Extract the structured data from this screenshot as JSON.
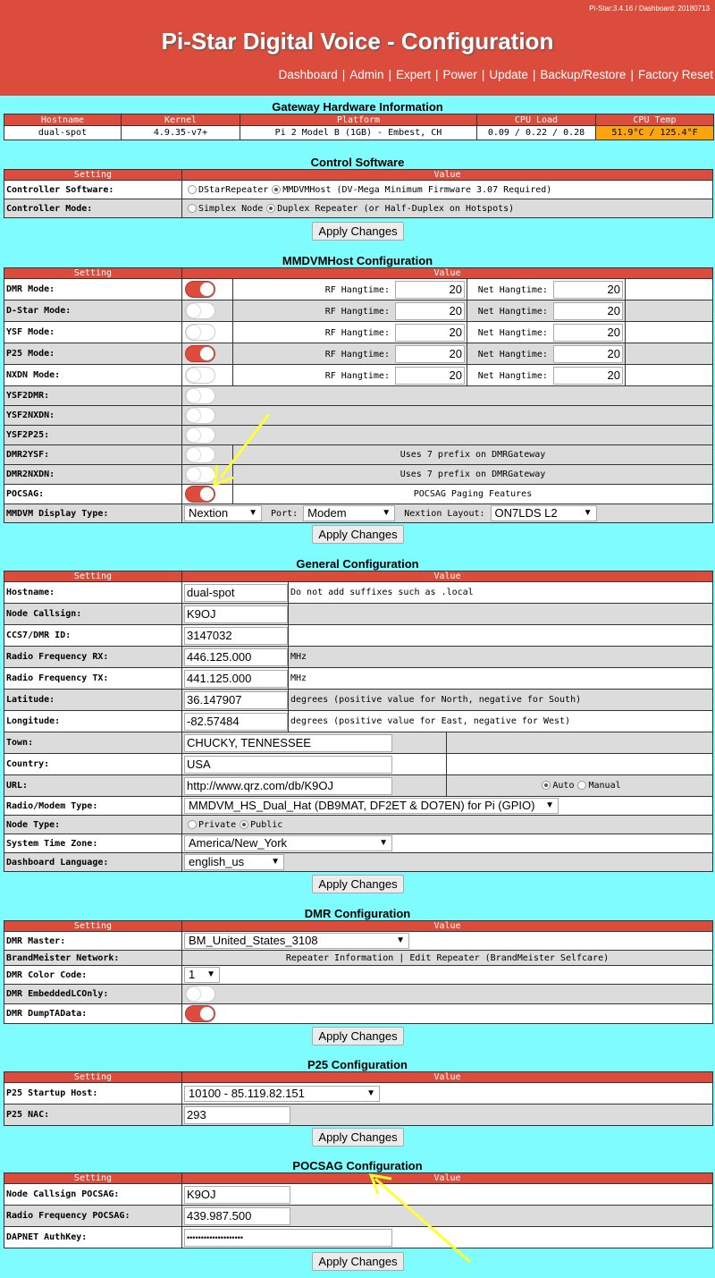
{
  "header": {
    "version": "Pi-Star:3.4.16 / Dashboard: 20180713",
    "title": "Pi-Star Digital Voice - Configuration",
    "nav": [
      "Dashboard",
      "Admin",
      "Expert",
      "Power",
      "Update",
      "Backup/Restore",
      "Factory Reset"
    ]
  },
  "apply_label": "Apply Changes",
  "gateway": {
    "title": "Gateway Hardware Information",
    "headers": [
      "Hostname",
      "Kernel",
      "Platform",
      "CPU Load",
      "CPU Temp"
    ],
    "values": [
      "dual-spot",
      "4.9.35-v7+",
      "Pi 2 Model B (1GB) - Embest, CH",
      "0.09 / 0.22 / 0.28",
      "51.9°C / 125.4°F"
    ],
    "temp_color": "#fca40d"
  },
  "columns": {
    "setting": "Setting",
    "value": "Value"
  },
  "control": {
    "title": "Control Software",
    "software_label": "Controller Software:",
    "software_options": [
      "DStarRepeater",
      "MMDVMHost (DV-Mega Minimum Firmware 3.07 Required)"
    ],
    "software_selected": "MMDVMHost",
    "mode_label": "Controller Mode:",
    "mode_options": [
      "Simplex Node",
      "Duplex Repeater (or Half-Duplex on Hotspots)"
    ],
    "mode_selected": "Duplex Repeater"
  },
  "mmdvm": {
    "title": "MMDVMHost Configuration",
    "rf_label": "RF Hangtime:",
    "net_label": "Net Hangtime:",
    "modes": [
      {
        "label": "DMR Mode:",
        "on": true,
        "rf": "20",
        "net": "20"
      },
      {
        "label": "D-Star Mode:",
        "on": false,
        "rf": "20",
        "net": "20"
      },
      {
        "label": "YSF Mode:",
        "on": false,
        "rf": "20",
        "net": "20"
      },
      {
        "label": "P25 Mode:",
        "on": true,
        "rf": "20",
        "net": "20"
      },
      {
        "label": "NXDN Mode:",
        "on": false,
        "rf": "20",
        "net": "20"
      }
    ],
    "ysf2dmr": "YSF2DMR:",
    "ysf2nxdn": "YSF2NXDN:",
    "ysf2p25": "YSF2P25:",
    "dmr2ysf": "DMR2YSF:",
    "dmr2ysf_note": "Uses 7 prefix on DMRGateway",
    "dmr2nxdn": "DMR2NXDN:",
    "dmr2nxdn_note": "Uses 7 prefix on DMRGateway",
    "pocsag": "POCSAG:",
    "pocsag_on": true,
    "pocsag_note": "POCSAG Paging Features",
    "display_label": "MMDVM Display Type:",
    "display_value": "Nextion",
    "port_label": "Port:",
    "port_value": "Modem",
    "layout_label": "Nextion Layout:",
    "layout_value": "ON7LDS L2"
  },
  "general": {
    "title": "General Configuration",
    "hostname_label": "Hostname:",
    "hostname": "dual-spot",
    "hostname_note": "Do not add suffixes such as .local",
    "callsign_label": "Node Callsign:",
    "callsign": "K9OJ",
    "dmrid_label": "CCS7/DMR ID:",
    "dmrid": "3147032",
    "rx_label": "Radio Frequency RX:",
    "rx": "446.125.000",
    "rx_unit": "MHz",
    "tx_label": "Radio Frequency TX:",
    "tx": "441.125.000",
    "tx_unit": "MHz",
    "lat_label": "Latitude:",
    "lat": "36.147907",
    "lat_note": "degrees (positive value for North, negative for South)",
    "lon_label": "Longitude:",
    "lon": "-82.57484",
    "lon_note": "degrees (positive value for East, negative for West)",
    "town_label": "Town:",
    "town": "CHUCKY, TENNESSEE",
    "country_label": "Country:",
    "country": "USA",
    "url_label": "URL:",
    "url": "http://www.qrz.com/db/K9OJ",
    "url_auto": "Auto",
    "url_manual": "Manual",
    "modem_label": "Radio/Modem Type:",
    "modem": "MMDVM_HS_Dual_Hat (DB9MAT, DF2ET & DO7EN) for Pi (GPIO)",
    "nodetype_label": "Node Type:",
    "private": "Private",
    "public": "Public",
    "tz_label": "System Time Zone:",
    "tz": "America/New_York",
    "lang_label": "Dashboard Language:",
    "lang": "english_us"
  },
  "dmr": {
    "title": "DMR Configuration",
    "master_label": "DMR Master:",
    "master": "BM_United_States_3108",
    "bm_label": "BrandMeister Network:",
    "bm_links": "Repeater Information | Edit Repeater (BrandMeister Selfcare)",
    "cc_label": "DMR Color Code:",
    "cc": "1",
    "elc_label": "DMR EmbeddedLCOnly:",
    "elc_on": false,
    "dta_label": "DMR DumpTAData:",
    "dta_on": true
  },
  "p25": {
    "title": "P25 Configuration",
    "host_label": "P25 Startup Host:",
    "host": "10100 - 85.119.82.151",
    "nac_label": "P25 NAC:",
    "nac": "293"
  },
  "pocsag": {
    "title": "POCSAG Configuration",
    "call_label": "Node Callsign POCSAG:",
    "call": "K9OJ",
    "freq_label": "Radio Frequency POCSAG:",
    "freq": "439.987.500",
    "auth_label": "DAPNET AuthKey:",
    "auth": "••••••••••••••••••••"
  },
  "colors": {
    "header": "#dc4c3c",
    "background": "#7ffcfd",
    "arrow": "#ffff33"
  }
}
